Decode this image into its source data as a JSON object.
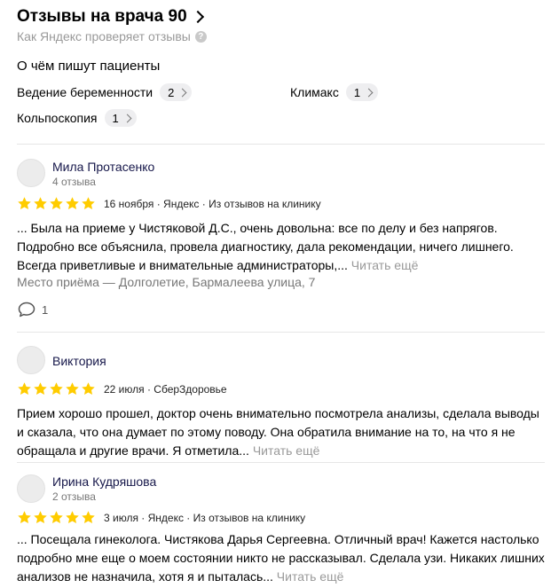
{
  "header": {
    "title": "Отзывы на врача 90",
    "subtitle": "Как Яндекс проверяет отзывы",
    "help_icon": "question-icon"
  },
  "topics": {
    "title": "О чём пишут пациенты",
    "items": [
      {
        "label": "Ведение беременности",
        "count": "2"
      },
      {
        "label": "Климакс",
        "count": "1"
      },
      {
        "label": "Кольпоскопия",
        "count": "1"
      }
    ]
  },
  "colors": {
    "star": "#ffcc00",
    "name": "#16174a",
    "muted": "#999999"
  },
  "reviews": [
    {
      "author": "Мила Протасенко",
      "reviews_count": "4 отзыва",
      "rating": 5,
      "meta": "16 ноября · Яндекс · Из отзывов на клинику",
      "text": "... Была на приеме у Чистяковой Д.С., очень довольна: все по делу и без напрягов. Подробно все объяснила, провела диагностику, дала рекомендации, ничего лишнего. Всегда приветливые и внимательные администраторы,...",
      "more": "Читать ещё",
      "place": "Место приёма — Долголетие, Бармалеева улица, 7",
      "comments": "1"
    },
    {
      "author": "Виктория",
      "rating": 5,
      "meta": "22 июля · СберЗдоровье",
      "text": "Прием хорошо прошел, доктор очень внимательно посмотрела анализы, сделала выводы и сказала, что она думает по этому поводу. Она обратила внимание на то, на что я не обращала и другие врачи. Я отметила...",
      "more": "Читать ещё"
    },
    {
      "author": "Ирина Кудряшова",
      "reviews_count": "2 отзыва",
      "rating": 5,
      "meta": "3 июля · Яндекс · Из отзывов на клинику",
      "text": "... Посещала гинеколога. Чистякова Дарья Сергеевна. Отличный врач! Кажется настолько подробно мне еще о моем состоянии никто не рассказывал. Сделала узи. Никаких лишних анализов не назначила, хотя я и пыталась...",
      "more": "Читать ещё"
    }
  ]
}
